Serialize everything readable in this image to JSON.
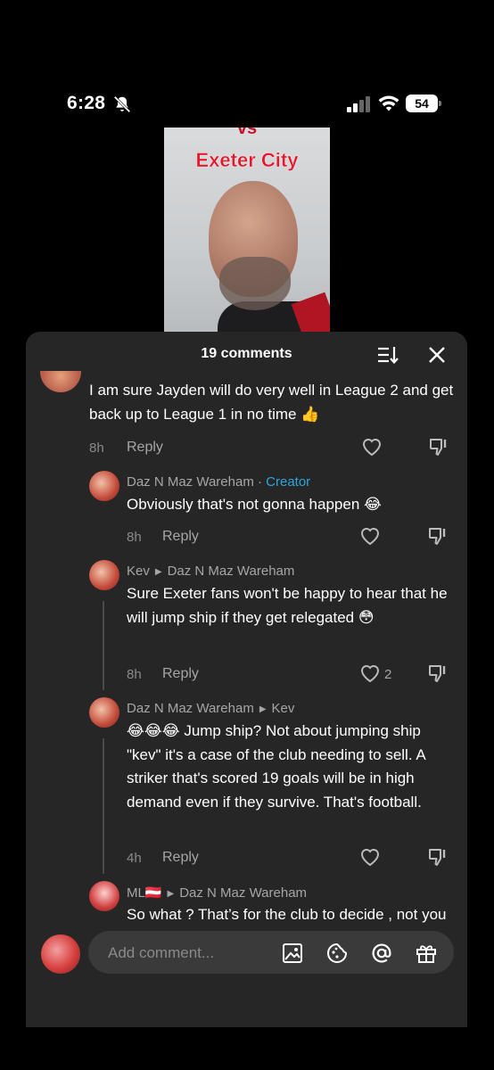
{
  "status": {
    "time": "6:28",
    "battery": "54"
  },
  "video": {
    "top_text": "vs",
    "title": "Exeter City"
  },
  "sheet": {
    "title": "19 comments"
  },
  "comments": [
    {
      "text": "I am sure Jayden will do very well in League 2 and get back up to League 1 in no time 👍",
      "time": "8h",
      "reply": "Reply",
      "likes": ""
    },
    {
      "author": "Daz N Maz Wareham",
      "separator": " · ",
      "badge": "Creator",
      "text": "Obviously that's not gonna happen 😂",
      "time": "8h",
      "reply": "Reply",
      "likes": ""
    },
    {
      "author": "Kev",
      "reply_to": "Daz N Maz Wareham",
      "text": "Sure Exeter fans won't be happy to hear that he will jump ship if they get relegated 😳",
      "time": "8h",
      "reply": "Reply",
      "likes": "2"
    },
    {
      "author": "Daz N Maz Wareham",
      "reply_to": "Kev",
      "text": "😂😂😂 Jump ship? Not about jumping ship \"kev\" it's a case of the club needing to sell. A striker that's scored 19 goals will be in high demand even if they survive. That's football.",
      "time": "4h",
      "reply": "Reply",
      "likes": ""
    },
    {
      "author": "ML🇦🇹",
      "reply_to": "Daz N Maz Wareham",
      "text": "So what ? That’s for the club to decide , not you basically deciding for yourself z"
    }
  ],
  "input": {
    "placeholder": "Add comment..."
  },
  "colors": {
    "sheet_bg": "#262626",
    "creator": "#2ea7df",
    "title_red": "#e3182d"
  }
}
